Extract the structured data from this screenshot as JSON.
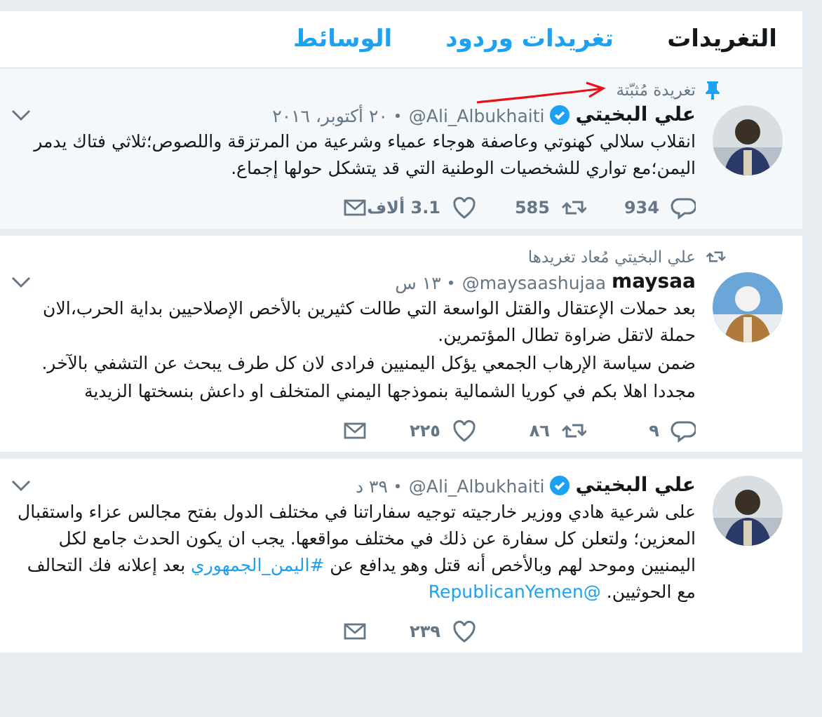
{
  "tabs": [
    {
      "label": "التغريدات",
      "selected": true
    },
    {
      "label": "تغريدات وردود",
      "selected": false
    },
    {
      "label": "الوسائط",
      "selected": false
    }
  ],
  "tweets": [
    {
      "context": {
        "kind": "pinned",
        "text": "تغريدة مُثبّتة",
        "annotated": true
      },
      "name": "علي البخيتي",
      "verified": true,
      "handle": "@Ali_Albukhaiti",
      "time": "٢٠ أكتوبر، ٢٠١٦",
      "avatar": {
        "kind": "picture"
      },
      "paragraphs": [
        [
          {
            "kind": "text",
            "text": "انقلاب سلالي كهنوتي وعاصفة هوجاء عمياء وشرعية من المرتزقة واللصوص؛ثلاثي فتاك يدمر اليمن؛مع تواري للشخصيات الوطنية التي قد يتشكل حولها إجماع."
          }
        ]
      ],
      "stats": {
        "replies": "934",
        "retweets": "585",
        "likes": "3.1 ألاف"
      }
    },
    {
      "context": {
        "kind": "retweet",
        "text": "علي البخيتي مُعاد تغريدها",
        "annotated": false
      },
      "name": "maysaa",
      "verified": false,
      "handle": "@maysaashujaa",
      "time": "١٣ س",
      "avatar": {
        "kind": "picture"
      },
      "paragraphs": [
        [
          {
            "kind": "text",
            "text": "بعد حملات الإعتقال والقتل الواسعة التي طالت كثيرين بالأخص الإصلاحيين بداية الحرب،الان حملة لاتقل ضراوة تطال المؤتمرين."
          }
        ],
        [
          {
            "kind": "text",
            "text": "ضمن سياسة الإرهاب الجمعي يؤكل اليمنيين فرادى لان كل طرف يبحث عن التشفي بالآخر."
          }
        ],
        [
          {
            "kind": "text",
            "text": "مجددا اهلا بكم في كوريا الشمالية بنموذجها اليمني المتخلف او داعش بنسختها الزيدية"
          }
        ]
      ],
      "stats": {
        "replies": "٩",
        "retweets": "٨٦",
        "likes": "٢٢٥"
      }
    },
    {
      "name": "علي البخيتي",
      "verified": true,
      "handle": "@Ali_Albukhaiti",
      "time": "٣٩ د",
      "avatar": {
        "kind": "picture"
      },
      "paragraphs": [
        [
          {
            "kind": "text",
            "text": "على شرعية هادي ووزير خارجيته توجيه سفاراتنا في مختلف الدول بفتح مجالس عزاء واستقبال المعزين؛ ولتعلن كل سفارة عن ذلك في مختلف مواقعها. يجب ان يكون الحدث جامع لكل اليمنيين وموحد لهم وبالأخص أنه قتل وهو يدافع عن "
          },
          {
            "kind": "hashtag",
            "text": "#اليمن_الجمهوري"
          },
          {
            "kind": "text",
            "text": " بعد إعلانه فك التحالف مع الحوثيين. "
          },
          {
            "kind": "mention",
            "text": "@RepublicanYemen"
          }
        ]
      ],
      "stats": {
        "likes": "٢٣٩"
      }
    }
  ]
}
